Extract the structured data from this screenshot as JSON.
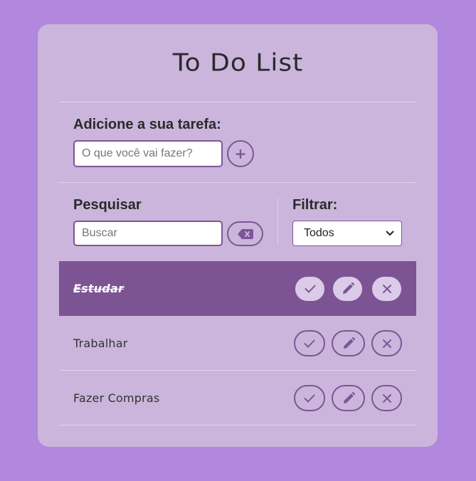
{
  "app": {
    "title": "To Do List"
  },
  "add": {
    "label": "Adicione a sua tarefa:",
    "placeholder": "O que você vai fazer?",
    "button_label": "+"
  },
  "search": {
    "label": "Pesquisar",
    "placeholder": "Buscar"
  },
  "filter": {
    "label": "Filtrar:",
    "selected": "Todos"
  },
  "todos": [
    {
      "text": "Estudar",
      "done": true
    },
    {
      "text": "Trabalhar",
      "done": false
    },
    {
      "text": "Fazer Compras",
      "done": false
    }
  ],
  "colors": {
    "background": "#b287de",
    "card": "#cbb5dc",
    "accent": "#7e5596",
    "done_row": "#7d5493"
  },
  "icons": {
    "add": "plus-icon",
    "clear_search": "backspace-icon",
    "finish": "check-icon",
    "edit": "pencil-icon",
    "remove": "x-icon",
    "select": "chevron-down-icon"
  }
}
